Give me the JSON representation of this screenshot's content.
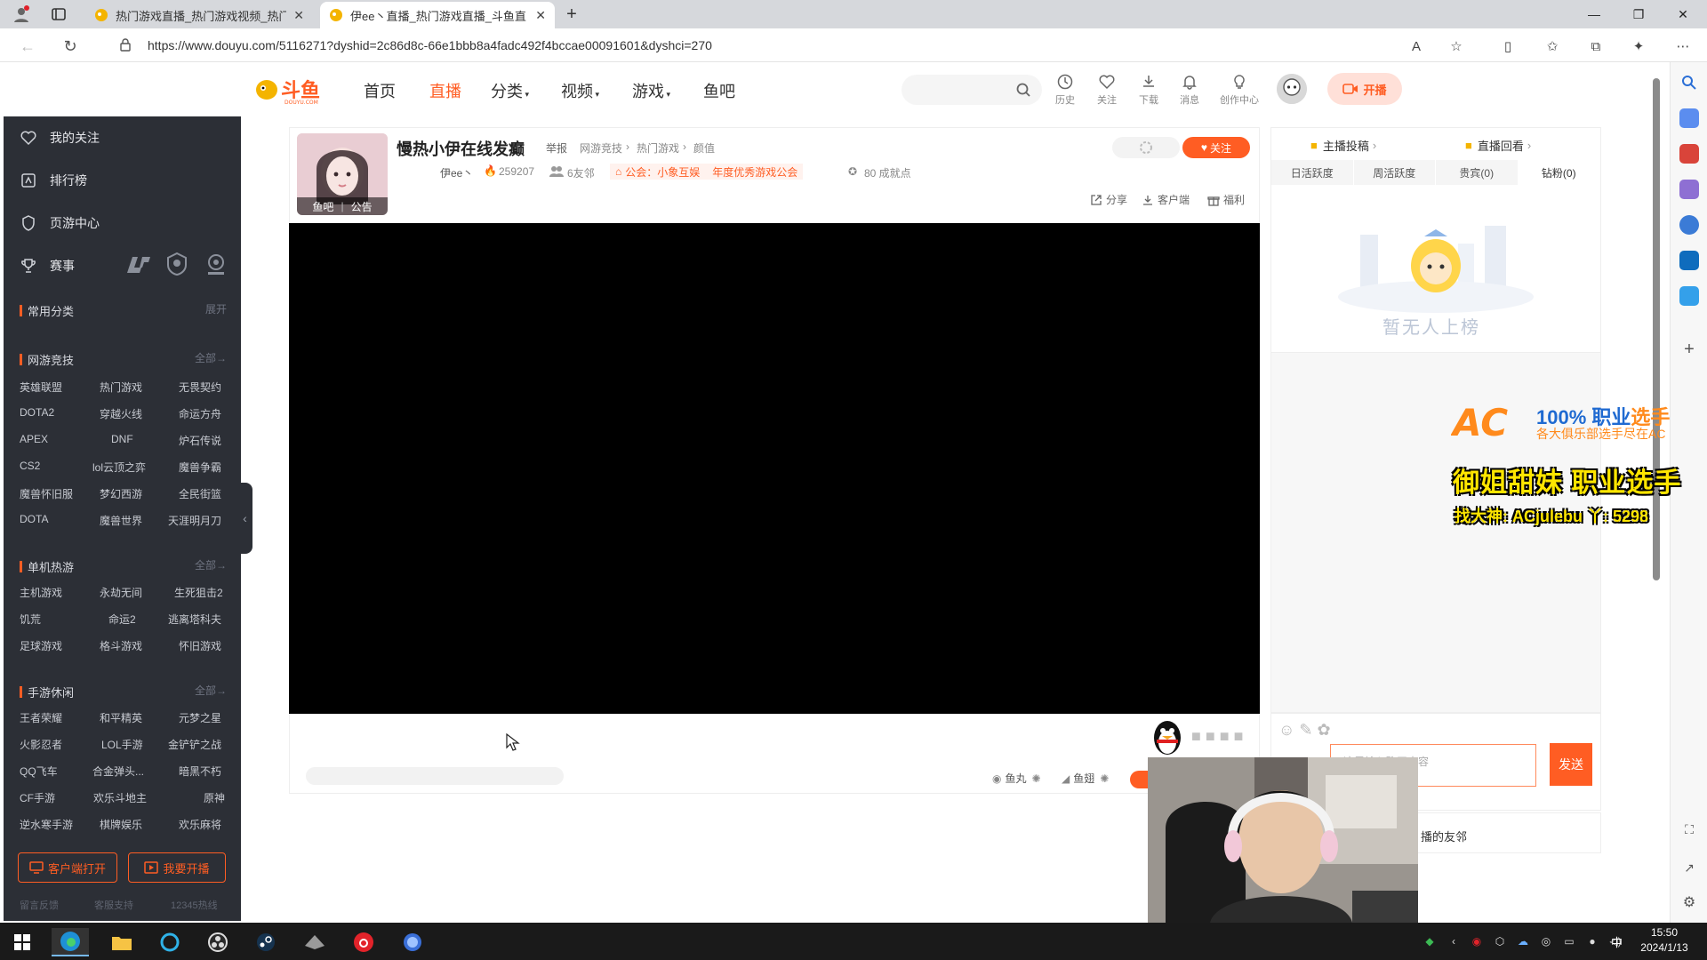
{
  "browser": {
    "tabs": [
      {
        "title": "热门游戏直播_热门游戏视频_热门",
        "active": false
      },
      {
        "title": "伊ee丶直播_热门游戏直播_斗鱼直",
        "active": true
      }
    ],
    "url": "https://www.douyu.com/5116271?dyshid=2c86d8c-66e1bbb8a4fadc492f4bccae00091601&dyshci=270"
  },
  "header": {
    "logo_text": "斗鱼",
    "logo_sub": "DOUYU.COM",
    "nav": [
      "首页",
      "直播",
      "分类",
      "视频",
      "游戏",
      "鱼吧"
    ],
    "tools": [
      "历史",
      "关注",
      "下载",
      "消息",
      "创作中心"
    ],
    "start_stream": "开播"
  },
  "sidebar": {
    "main": [
      "我的关注",
      "排行榜",
      "页游中心",
      "赛事"
    ],
    "common": {
      "title": "常用分类",
      "more": "展开"
    },
    "sections": [
      {
        "title": "网游竞技",
        "more": "全部",
        "items": [
          "英雄联盟",
          "热门游戏",
          "无畏契约",
          "DOTA2",
          "穿越火线",
          "命运方舟",
          "APEX",
          "DNF",
          "炉石传说",
          "CS2",
          "lol云顶之弈",
          "魔兽争霸",
          "魔兽怀旧服",
          "梦幻西游",
          "全民街篮",
          "DOTA",
          "魔兽世界",
          "天涯明月刀"
        ]
      },
      {
        "title": "单机热游",
        "more": "全部",
        "items": [
          "主机游戏",
          "永劫无间",
          "生死狙击2",
          "饥荒",
          "命运2",
          "逃离塔科夫",
          "足球游戏",
          "格斗游戏",
          "怀旧游戏"
        ]
      },
      {
        "title": "手游休闲",
        "more": "全部",
        "items": [
          "王者荣耀",
          "和平精英",
          "元梦之星",
          "火影忍者",
          "LOL手游",
          "金铲铲之战",
          "QQ飞车",
          "合金弹头...",
          "暗黑不朽",
          "CF手游",
          "欢乐斗地主",
          "原神",
          "逆水寒手游",
          "棋牌娱乐",
          "欢乐麻将"
        ]
      }
    ],
    "client_btn": "客户端打开",
    "stream_btn": "我要开播",
    "footer": [
      "留言反馈",
      "客服支持",
      "12345热线"
    ]
  },
  "room": {
    "title": "慢热小伊在线发癫",
    "report": "举报",
    "breadcrumb": [
      "网游竞技",
      "热门游戏",
      "颜值"
    ],
    "anchor": "伊ee丶",
    "hot": "259207",
    "friends": "6友邻",
    "guild": "公会：小象互娱",
    "guild_badge": "年度优秀游戏公会",
    "points": "80 成就点",
    "avatar_tags": [
      "鱼吧",
      "公告"
    ],
    "follow": "关注",
    "actions": [
      "分享",
      "客户端",
      "福利"
    ],
    "player_bar": [
      "鱼丸",
      "鱼翅"
    ]
  },
  "rank": {
    "top": [
      "主播投稿",
      "直播回看"
    ],
    "tabs": [
      "日活跃度",
      "周活跃度",
      "贵宾(0)",
      "钻粉(0)"
    ],
    "empty": "暂无人上榜"
  },
  "ad": {
    "logo": "AC",
    "line1a": "100% 职业",
    "line1b": "选手",
    "line2": "各大俱乐部选手尽在AC",
    "line3": "御姐甜妹 职业选手",
    "line4": "找大神: ACjulebu  丫: 5298"
  },
  "chat": {
    "placeholder": "这里输入聊天内容",
    "send": "发送",
    "friends": "播的友邻"
  },
  "taskbar": {
    "time": "15:50",
    "date": "2024/1/13",
    "ime": "中"
  },
  "colors": {
    "accent": "#ff5d23",
    "sidebar": "#2c2f36"
  }
}
